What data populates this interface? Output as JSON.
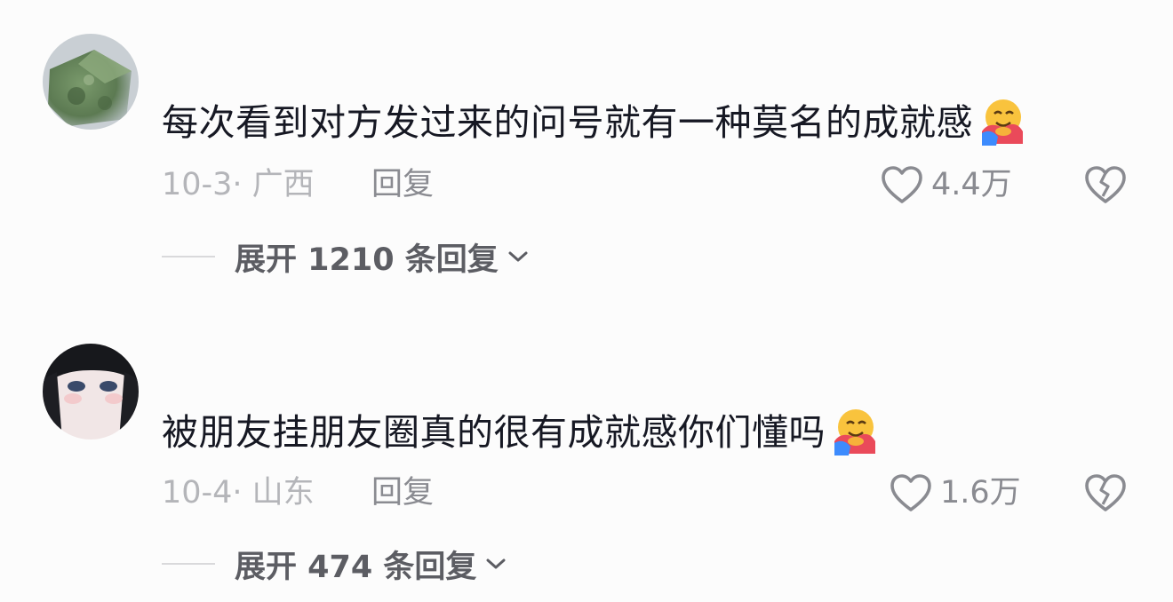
{
  "comments": [
    {
      "text": "每次看到对方发过来的问号就有一种莫名的成就感",
      "emoji": "hugging-face-emoji",
      "date_location": "10-3· 广西",
      "reply_label": "回复",
      "like_count": "4.4万",
      "expand_label": "展开 1210 条回复"
    },
    {
      "text": "被朋友挂朋友圈真的很有成就感你们懂吗",
      "emoji": "hugging-face-emoji",
      "date_location": "10-4· 山东",
      "reply_label": "回复",
      "like_count": "1.6万",
      "expand_label": "展开 474 条回复"
    }
  ],
  "icons": {
    "like": "heart-outline-icon",
    "dislike": "broken-heart-icon",
    "expand": "chevron-down-icon"
  },
  "colors": {
    "background": "#fcfcfc",
    "text_primary": "#161823",
    "text_secondary": "#8a8b91",
    "text_muted": "#b4b5b9"
  }
}
